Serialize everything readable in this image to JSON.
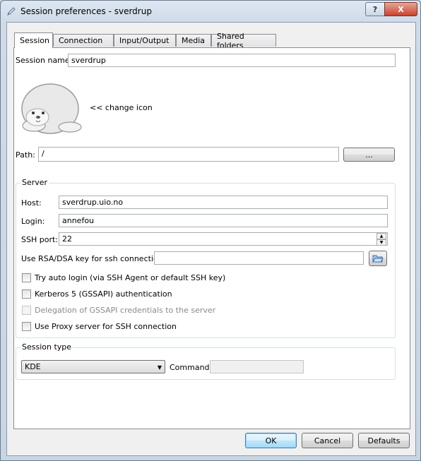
{
  "window": {
    "title": "Session preferences - sverdrup",
    "help_label": "?",
    "close_label": "X"
  },
  "tabs": [
    "Session",
    "Connection",
    "Input/Output",
    "Media",
    "Shared folders"
  ],
  "session": {
    "name_label": "Session name:",
    "name_value": "sverdrup",
    "change_icon_label": "<< change icon",
    "path_label": "Path:",
    "path_value": "/",
    "browse_label": "..."
  },
  "server": {
    "group_label": "Server",
    "host_label": "Host:",
    "host_value": "sverdrup.uio.no",
    "login_label": "Login:",
    "login_value": "annefou",
    "ssh_port_label": "SSH port:",
    "ssh_port_value": "22",
    "rsa_label": "Use RSA/DSA key for ssh connection:",
    "rsa_value": "",
    "auto_login_label": "Try auto login (via SSH Agent or default SSH key)",
    "kerberos_label": "Kerberos 5 (GSSAPI) authentication",
    "delegation_label": "Delegation of GSSAPI credentials to the server",
    "proxy_label": "Use Proxy server for SSH connection"
  },
  "session_type": {
    "group_label": "Session type",
    "selected": "KDE",
    "command_label": "Command:",
    "command_value": ""
  },
  "footer": {
    "ok_label": "OK",
    "cancel_label": "Cancel",
    "defaults_label": "Defaults"
  }
}
